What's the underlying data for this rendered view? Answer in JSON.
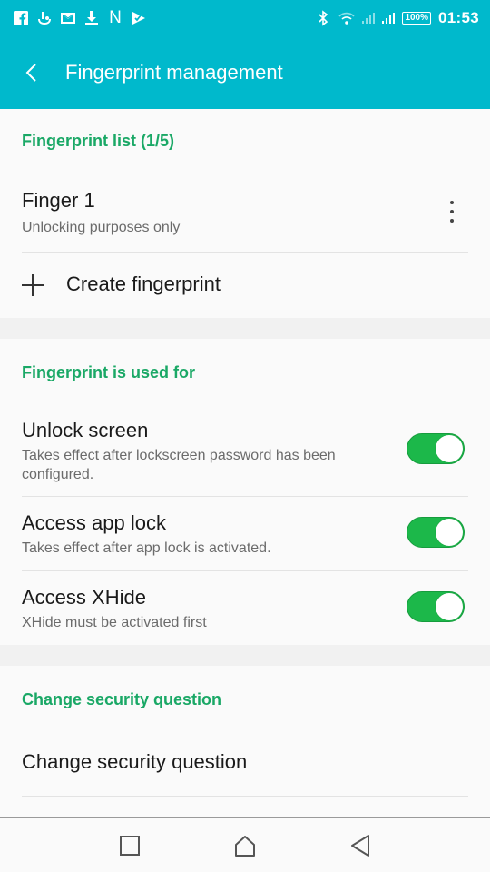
{
  "status_bar": {
    "left_icons": [
      "facebook-icon",
      "touchpal-icon",
      "gmail-icon",
      "download-icon",
      "n-icon",
      "checkmark-app-icon"
    ],
    "n_label": "N",
    "battery": "100%",
    "time": "01:53"
  },
  "app_bar": {
    "title": "Fingerprint management",
    "back_icon": "chevron-left-icon"
  },
  "sections": {
    "fingerprint_list": {
      "header": "Fingerprint list (1/5)",
      "fingers": [
        {
          "name": "Finger 1",
          "subtitle": "Unlocking purposes only"
        }
      ],
      "create_label": "Create fingerprint"
    },
    "used_for": {
      "header": "Fingerprint is used for",
      "items": [
        {
          "title": "Unlock screen",
          "subtitle": "Takes effect after lockscreen password has been configured.",
          "enabled": true
        },
        {
          "title": "Access app lock",
          "subtitle": "Takes effect after app lock is activated.",
          "enabled": true
        },
        {
          "title": "Access XHide",
          "subtitle": "XHide must be activated first",
          "enabled": true
        }
      ]
    },
    "security": {
      "header": "Change security question",
      "item": "Change security question"
    }
  },
  "nav_bar": {
    "buttons": [
      "recents-icon",
      "home-icon",
      "back-icon"
    ]
  },
  "colors": {
    "accent": "#00b9cc",
    "section_header": "#1aa866",
    "toggle_on": "#1cb84a"
  }
}
